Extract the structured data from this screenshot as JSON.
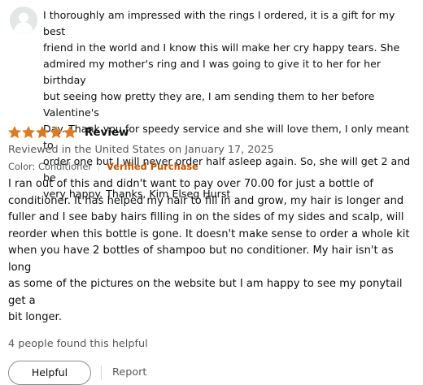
{
  "previous_review": {
    "avatar_icon": "user-avatar-icon",
    "body": "I thoroughly am impressed with the rings I ordered, it is a gift for my best\nfriend in the world and I know this will make her cry happy tears. She\nadmired my mother's ring and I was going to give it to her for her birthday\nbut seeing how pretty they are, I am sending them to her before Valentine's\nDay. Thank you for speedy service and she will love them, I only meant to\norder one but I will never order half asleep again. So, she will get 2 and be\nvery happy. Thanks, Kim Elseg Hurst"
  },
  "review": {
    "rating": 5,
    "rating_max": 5,
    "star_color": "#de7921",
    "title": "Review",
    "date": "Reviewed in the United States on January 17, 2025",
    "variant": "Color: Conditioner",
    "verified": "Verified Purchase",
    "verified_color": "#c45500",
    "body": "I ran out of this and didn't want to pay over 70.00 for just a bottle of\nconditioner. It has helped my hair to fill in and grow, my hair is longer and\nfuller and I see baby hairs filling in on the sides of my sides and scalp, will\nreorder when this bottle is gone. It doesn't make sense to order a whole kit\nwhen you have 2 bottles of shampoo but no conditioner. My hair isn't as long\nas some of the pictures on the website but I am happy to see my ponytail get a\nbit longer.",
    "helpful_count": "4 people found this helpful",
    "helpful_label": "Helpful",
    "report_label": "Report"
  }
}
